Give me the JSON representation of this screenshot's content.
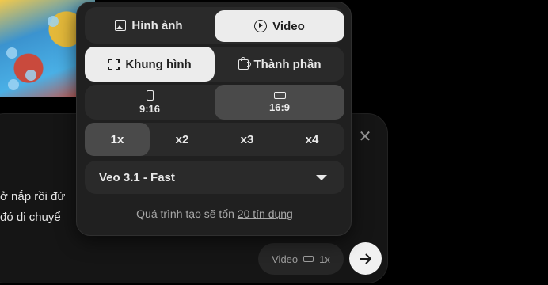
{
  "background": {
    "prompt_lines": [
      "ở nắp rồi đứ",
      "đó di chuyể"
    ],
    "chip": {
      "type": "Video",
      "count": "1x",
      "icon": "landscape-icon"
    },
    "send_icon": "arrow-right-icon",
    "close_icon": "close-icon"
  },
  "panel": {
    "type_tabs": [
      {
        "label": "Hình ảnh",
        "icon": "image-icon",
        "selected": false
      },
      {
        "label": "Video",
        "icon": "play-icon",
        "selected": true
      }
    ],
    "mode_tabs": [
      {
        "label": "Khung hình",
        "icon": "frame-icon",
        "selected": true
      },
      {
        "label": "Thành phần",
        "icon": "puzzle-icon",
        "selected": false
      }
    ],
    "aspect_options": [
      {
        "label": "9:16",
        "icon": "portrait-icon",
        "selected": false
      },
      {
        "label": "16:9",
        "icon": "landscape-icon",
        "selected": true
      }
    ],
    "count_options": [
      {
        "label": "1x",
        "selected": true
      },
      {
        "label": "x2",
        "selected": false
      },
      {
        "label": "x3",
        "selected": false
      },
      {
        "label": "x4",
        "selected": false
      }
    ],
    "model": {
      "label": "Veo 3.1 - Fast"
    },
    "credits": {
      "prefix": "Quá trình tạo sẽ tốn ",
      "link": "20 tín dụng"
    }
  },
  "colors": {
    "panel_bg": "#202020",
    "segment_bg": "#2a2a2a",
    "active_bg": "#ececec",
    "selected_gray": "#4a4a4a"
  }
}
